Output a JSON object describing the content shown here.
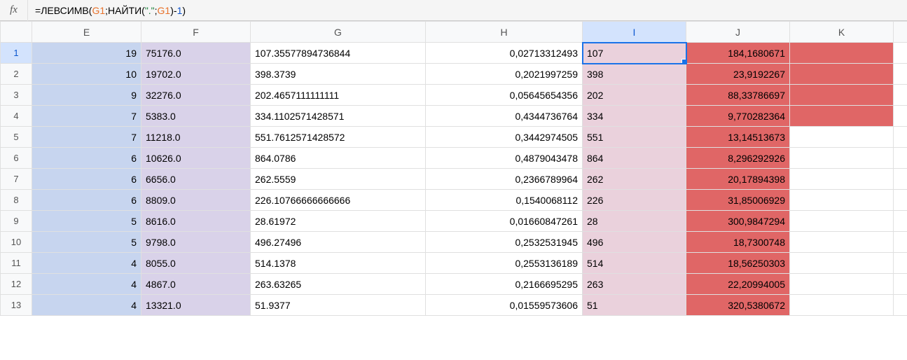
{
  "formula": {
    "prefix": "=",
    "fn1": "ЛЕВСИМВ",
    "open1": "(",
    "ref1": "G1",
    "sep1": ";",
    "fn2": "НАЙТИ",
    "open2": "(",
    "str": "\".\"",
    "sep2": ";",
    "ref2": "G1",
    "close2": ")",
    "minus": "-",
    "num": "1",
    "close1": ")"
  },
  "columns": [
    "E",
    "F",
    "G",
    "H",
    "I",
    "J",
    "K"
  ],
  "rows": [
    {
      "n": "1",
      "E": "19",
      "F": "75176.0",
      "G": "107.35577894736844",
      "H": "0,02713312493",
      "I": "107",
      "J": "184,1680671",
      "K": "",
      "kred": true
    },
    {
      "n": "2",
      "E": "10",
      "F": "19702.0",
      "G": "398.3739",
      "H": "0,2021997259",
      "I": "398",
      "J": "23,9192267",
      "K": "",
      "kred": true
    },
    {
      "n": "3",
      "E": "9",
      "F": "32276.0",
      "G": "202.4657111111111",
      "H": "0,05645654356",
      "I": "202",
      "J": "88,33786697",
      "K": "",
      "kred": true
    },
    {
      "n": "4",
      "E": "7",
      "F": "5383.0",
      "G": "334.1102571428571",
      "H": "0,4344736764",
      "I": "334",
      "J": "9,770282364",
      "K": "",
      "kred": true
    },
    {
      "n": "5",
      "E": "7",
      "F": "11218.0",
      "G": "551.7612571428572",
      "H": "0,3442974505",
      "I": "551",
      "J": "13,14513673",
      "K": "",
      "kred": false
    },
    {
      "n": "6",
      "E": "6",
      "F": "10626.0",
      "G": "864.0786",
      "H": "0,4879043478",
      "I": "864",
      "J": "8,296292926",
      "K": "",
      "kred": false
    },
    {
      "n": "7",
      "E": "6",
      "F": "6656.0",
      "G": "262.5559",
      "H": "0,2366789964",
      "I": "262",
      "J": "20,17894398",
      "K": "",
      "kred": false
    },
    {
      "n": "8",
      "E": "6",
      "F": "8809.0",
      "G": "226.10766666666666",
      "H": "0,1540068112",
      "I": "226",
      "J": "31,85006929",
      "K": "",
      "kred": false
    },
    {
      "n": "9",
      "E": "5",
      "F": "8616.0",
      "G": "28.61972",
      "H": "0,01660847261",
      "I": "28",
      "J": "300,9847294",
      "K": "",
      "kred": false
    },
    {
      "n": "10",
      "E": "5",
      "F": "9798.0",
      "G": "496.27496",
      "H": "0,2532531945",
      "I": "496",
      "J": "18,7300748",
      "K": "",
      "kred": false
    },
    {
      "n": "11",
      "E": "4",
      "F": "8055.0",
      "G": "514.1378",
      "H": "0,2553136189",
      "I": "514",
      "J": "18,56250303",
      "K": "",
      "kred": false
    },
    {
      "n": "12",
      "E": "4",
      "F": "4867.0",
      "G": "263.63265",
      "H": "0,2166695295",
      "I": "263",
      "J": "22,20994005",
      "K": "",
      "kred": false
    },
    {
      "n": "13",
      "E": "4",
      "F": "13321.0",
      "G": "51.9377",
      "H": "0,01559573606",
      "I": "51",
      "J": "320,5380672",
      "K": "",
      "kred": false
    }
  ],
  "active": {
    "row": "1",
    "col": "I"
  },
  "chart_data": {
    "type": "table",
    "columns": [
      "E",
      "F",
      "G",
      "H",
      "I",
      "J",
      "K"
    ],
    "data": [
      [
        19,
        "75176.0",
        "107.35577894736844",
        "0,02713312493",
        "107",
        "184,1680671",
        ""
      ],
      [
        10,
        "19702.0",
        "398.3739",
        "0,2021997259",
        "398",
        "23,9192267",
        ""
      ],
      [
        9,
        "32276.0",
        "202.4657111111111",
        "0,05645654356",
        "202",
        "88,33786697",
        ""
      ],
      [
        7,
        "5383.0",
        "334.1102571428571",
        "0,4344736764",
        "334",
        "9,770282364",
        ""
      ],
      [
        7,
        "11218.0",
        "551.7612571428572",
        "0,3442974505",
        "551",
        "13,14513673",
        ""
      ],
      [
        6,
        "10626.0",
        "864.0786",
        "0,4879043478",
        "864",
        "8,296292926",
        ""
      ],
      [
        6,
        "6656.0",
        "262.5559",
        "0,2366789964",
        "262",
        "20,17894398",
        ""
      ],
      [
        6,
        "8809.0",
        "226.10766666666666",
        "0,1540068112",
        "226",
        "31,85006929",
        ""
      ],
      [
        5,
        "8616.0",
        "28.61972",
        "0,01660847261",
        "28",
        "300,9847294",
        ""
      ],
      [
        5,
        "9798.0",
        "496.27496",
        "0,2532531945",
        "496",
        "18,7300748",
        ""
      ],
      [
        4,
        "8055.0",
        "514.1378",
        "0,2553136189",
        "514",
        "18,56250303",
        ""
      ],
      [
        4,
        "4867.0",
        "263.63265",
        "0,2166695295",
        "263",
        "22,20994005",
        ""
      ],
      [
        4,
        "13321.0",
        "51.9377",
        "0,01559573606",
        "51",
        "320,5380672",
        ""
      ]
    ]
  }
}
